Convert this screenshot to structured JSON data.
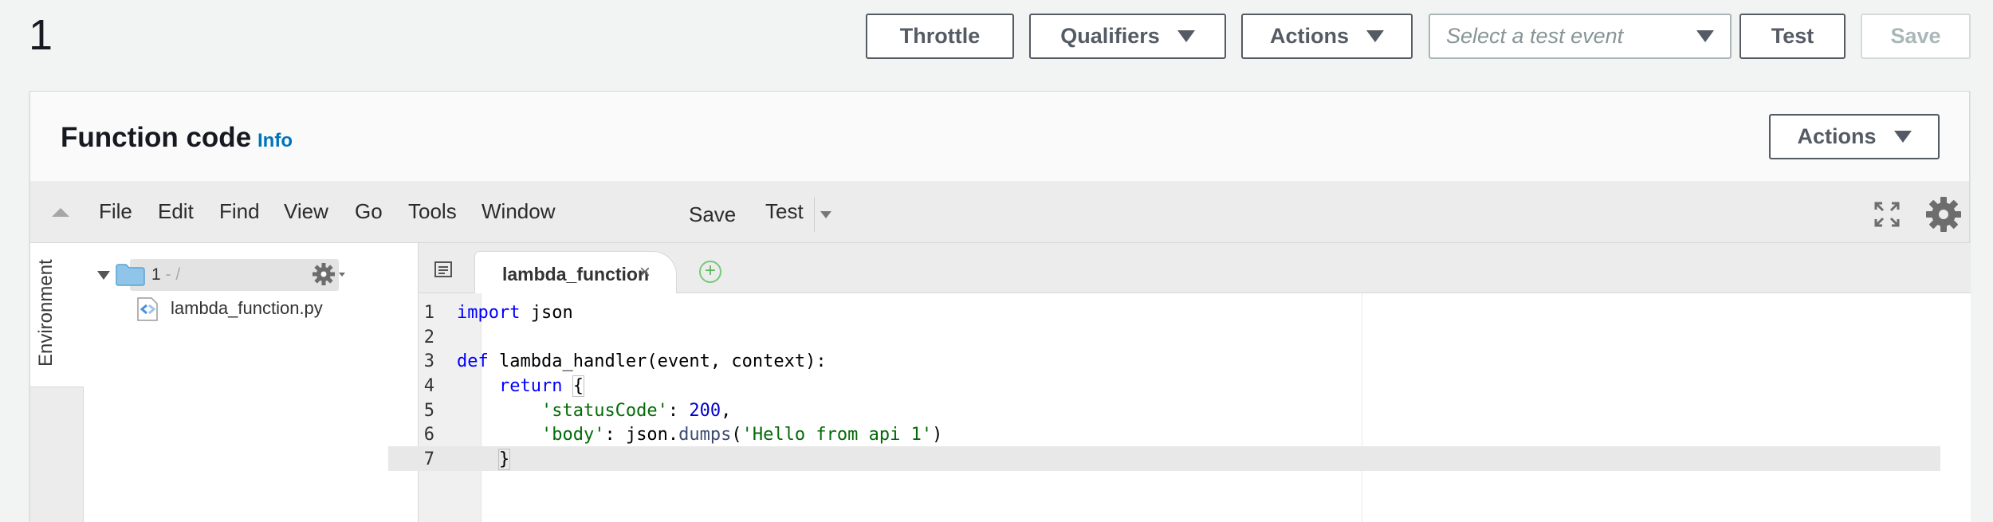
{
  "header": {
    "function_name": "1",
    "throttle_label": "Throttle",
    "qualifiers_label": "Qualifiers",
    "actions_label": "Actions",
    "test_event_placeholder": "Select a test event",
    "test_label": "Test",
    "save_label": "Save"
  },
  "panel": {
    "title": "Function code",
    "info_label": "Info",
    "actions_label": "Actions"
  },
  "ide": {
    "menu": [
      "File",
      "Edit",
      "Find",
      "View",
      "Go",
      "Tools",
      "Window"
    ],
    "save_label": "Save",
    "test_label": "Test",
    "environment_label": "Environment",
    "tree": {
      "root_name": "1",
      "root_path": " - /",
      "files": [
        "lambda_function.py"
      ]
    },
    "active_tab": "lambda_function",
    "code_lines": [
      {
        "n": "1",
        "text": "import json"
      },
      {
        "n": "2",
        "text": ""
      },
      {
        "n": "3",
        "text": "def lambda_handler(event, context):"
      },
      {
        "n": "4",
        "text": "    return {"
      },
      {
        "n": "5",
        "text": "        'statusCode': 200,"
      },
      {
        "n": "6",
        "text": "        'body': json.dumps('Hello from api 1')"
      },
      {
        "n": "7",
        "text": "    }"
      }
    ]
  },
  "colors": {
    "link": "#0073bb",
    "keyword": "#0000ff",
    "string": "#036a07",
    "number": "#0000cd"
  }
}
